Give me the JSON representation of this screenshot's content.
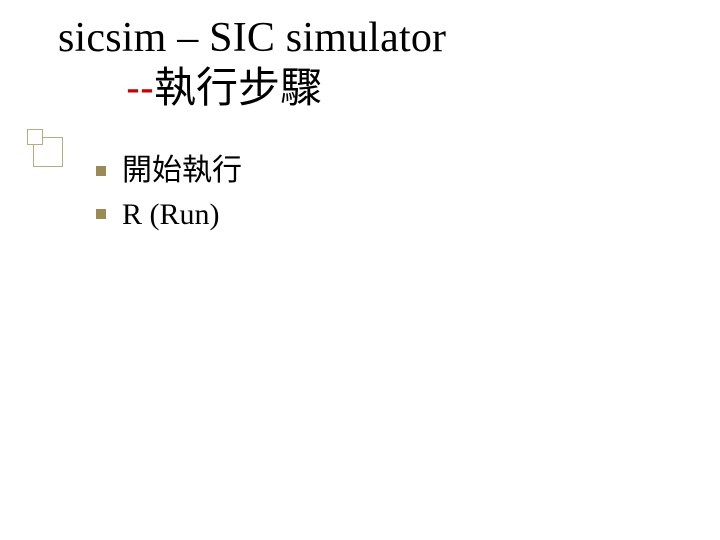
{
  "title": {
    "line1": "sicsim – SIC simulator",
    "dashes": "--",
    "line2_cjk": "執行步驟"
  },
  "bullets": [
    {
      "text": "開始執行",
      "cjk": true
    },
    {
      "text": "R  (Run)",
      "cjk": false
    }
  ],
  "colors": {
    "accent_red": "#cc0000",
    "bullet_olive": "#9b8a54",
    "deco_border": "#b9ab7c"
  }
}
